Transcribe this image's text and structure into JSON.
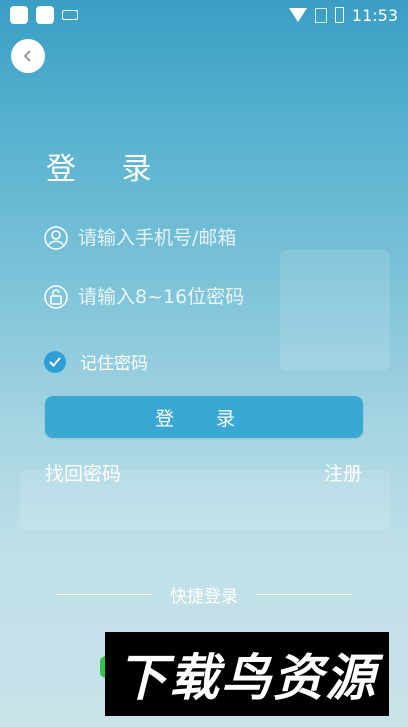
{
  "status_bar": {
    "time": "11:53"
  },
  "header": {
    "title": "登 录"
  },
  "form": {
    "account_placeholder": "请输入手机号/邮箱",
    "password_placeholder": "请输入8~16位密码",
    "remember_label": "记住密码",
    "remember_checked": true,
    "login_button": "登 录"
  },
  "links": {
    "forgot": "找回密码",
    "register": "注册"
  },
  "quick_login": {
    "label": "快捷登录"
  },
  "watermark": {
    "text": "下载鸟资源"
  },
  "colors": {
    "accent": "#3aa8d4",
    "check": "#2e9fd6"
  }
}
